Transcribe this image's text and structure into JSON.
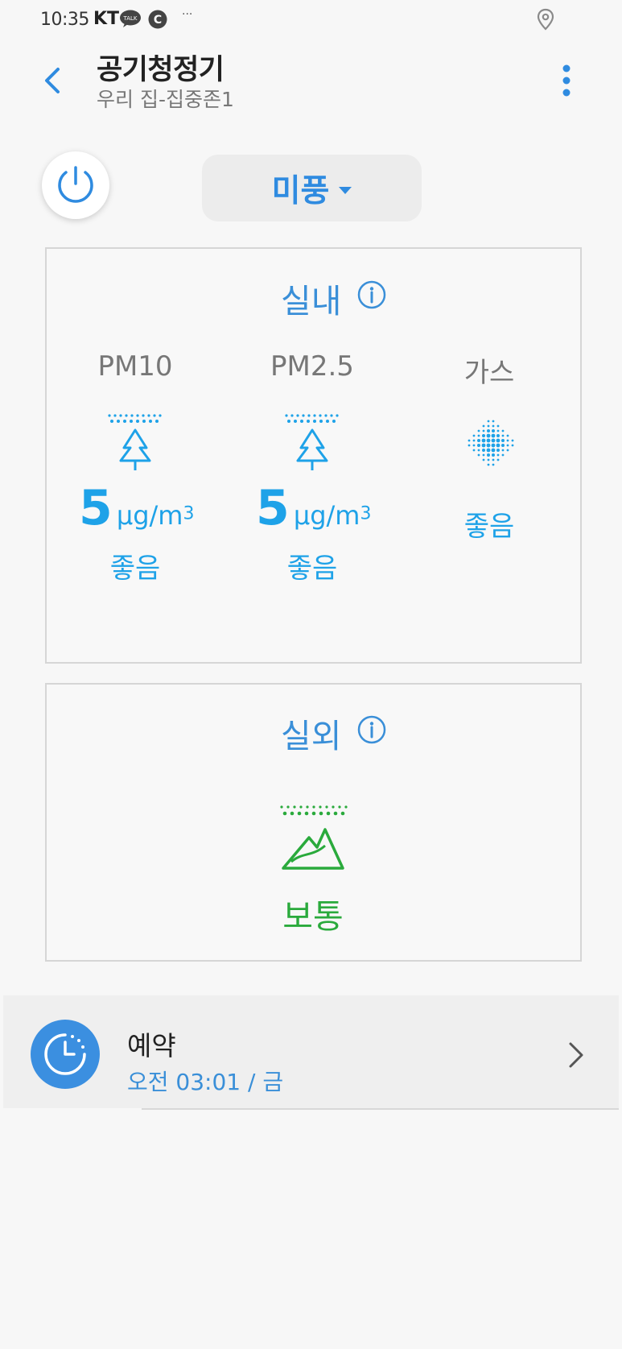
{
  "status_bar": {
    "time": "10:35",
    "carrier": "KT",
    "talk_badge": "TALK",
    "c_badge": "C",
    "more": "···",
    "icons": [
      "talk-icon",
      "c-icon",
      "location-icon"
    ]
  },
  "header": {
    "title": "공기청정기",
    "subtitle": "우리 집-집중존1",
    "icons": [
      "back-arrow-icon",
      "more-vertical-icon"
    ]
  },
  "controls": {
    "mode_label": "미풍",
    "icons": [
      "power-icon",
      "caret-down-icon"
    ]
  },
  "indoor": {
    "title": "실내",
    "metrics": [
      {
        "label": "PM10",
        "value": "5",
        "unit": "μg/m",
        "unit_sup": "3",
        "status": "좋음",
        "icon": "tree-air-good-icon"
      },
      {
        "label": "PM2.5",
        "value": "5",
        "unit": "μg/m",
        "unit_sup": "3",
        "status": "좋음",
        "icon": "tree-air-good-icon"
      },
      {
        "label": "가스",
        "status": "좋음",
        "icon": "gas-dots-icon"
      }
    ]
  },
  "outdoor": {
    "title": "실외",
    "status": "보통",
    "icon": "mountain-air-moderate-icon"
  },
  "schedule": {
    "title": "예약",
    "time": "오전 03:01 / 금",
    "icons": [
      "clock-icon",
      "chevron-right-icon"
    ]
  },
  "colors": {
    "accent_blue": "#2f8be0",
    "good_cyan": "#1ea2e8",
    "moderate_green": "#2aaa3c",
    "background": "#f7f7f7"
  }
}
